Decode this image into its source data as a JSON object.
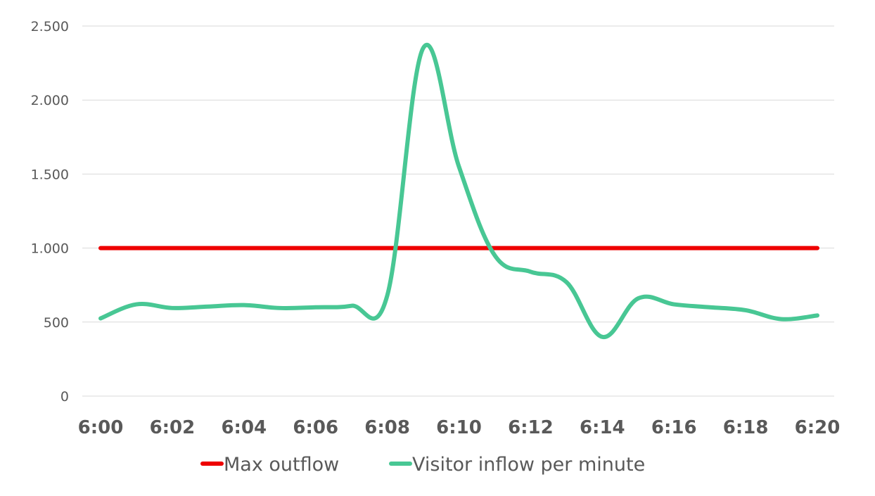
{
  "chart_data": {
    "type": "line",
    "title": "",
    "xlabel": "",
    "ylabel": "",
    "x": [
      "6:00",
      "6:01",
      "6:02",
      "6:03",
      "6:04",
      "6:05",
      "6:06",
      "6:07",
      "6:08",
      "6:09",
      "6:10",
      "6:11",
      "6:12",
      "6:13",
      "6:14",
      "6:15",
      "6:16",
      "6:17",
      "6:18",
      "6:19",
      "6:20"
    ],
    "x_tick_labels": [
      "6:00",
      "6:02",
      "6:04",
      "6:06",
      "6:08",
      "6:10",
      "6:12",
      "6:14",
      "6:16",
      "6:18",
      "6:20"
    ],
    "ylim": [
      0,
      2500
    ],
    "y_ticks": [
      0,
      500,
      1000,
      1500,
      2000,
      2500
    ],
    "y_tick_labels": [
      "0",
      "500",
      "1.000",
      "1.500",
      "2.000",
      "2.500"
    ],
    "grid": true,
    "legend_position": "bottom",
    "series": [
      {
        "name": "Max outflow",
        "color": "#ee0000",
        "smooth": false,
        "values": [
          1000,
          1000,
          1000,
          1000,
          1000,
          1000,
          1000,
          1000,
          1000,
          1000,
          1000,
          1000,
          1000,
          1000,
          1000,
          1000,
          1000,
          1000,
          1000,
          1000,
          1000
        ]
      },
      {
        "name": "Visitor inflow per minute",
        "color": "#48c794",
        "smooth": true,
        "values": [
          525,
          620,
          595,
          605,
          615,
          595,
          600,
          610,
          680,
          2350,
          1550,
          950,
          840,
          770,
          400,
          660,
          620,
          600,
          580,
          520,
          545
        ]
      }
    ]
  }
}
